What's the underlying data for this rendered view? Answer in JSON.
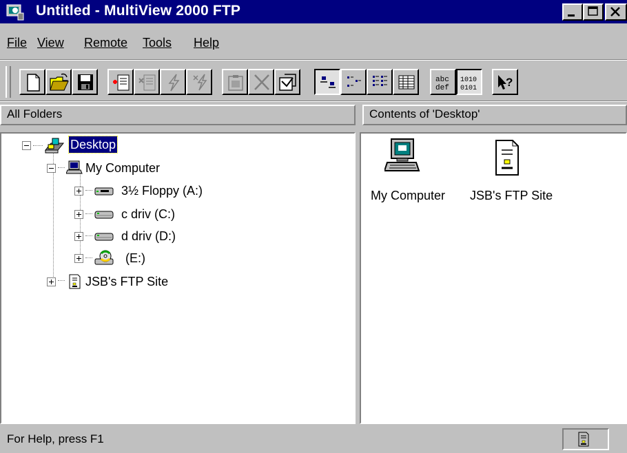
{
  "window": {
    "title": "Untitled - MultiView 2000 FTP",
    "controls": [
      "minimize",
      "maximize",
      "close"
    ]
  },
  "menu": [
    {
      "label": "File",
      "mnemonic": "F"
    },
    {
      "label": "View",
      "mnemonic": "V"
    },
    {
      "label": "Remote",
      "mnemonic": "R"
    },
    {
      "label": "Tools",
      "mnemonic": "T"
    },
    {
      "label": "Help",
      "mnemonic": "H"
    }
  ],
  "toolbar": {
    "buttons": [
      {
        "name": "new-icon",
        "enabled": true
      },
      {
        "name": "open-folder-icon",
        "enabled": true
      },
      {
        "name": "save-icon",
        "enabled": true
      },
      {
        "name": "connect-icon",
        "enabled": true
      },
      {
        "name": "disconnect-icon",
        "enabled": false
      },
      {
        "name": "lightning-icon",
        "enabled": false
      },
      {
        "name": "multi-lightning-icon",
        "enabled": false
      },
      {
        "name": "clipboard-icon",
        "enabled": false
      },
      {
        "name": "delete-icon",
        "enabled": false
      },
      {
        "name": "properties-icon",
        "enabled": true
      },
      {
        "name": "large-icons-view-icon",
        "enabled": true,
        "pressed": true
      },
      {
        "name": "small-icons-view-icon",
        "enabled": true
      },
      {
        "name": "list-view-icon",
        "enabled": true
      },
      {
        "name": "details-view-icon",
        "enabled": true
      },
      {
        "name": "ascii-mode-icon",
        "enabled": true,
        "text": "abc def"
      },
      {
        "name": "binary-mode-icon",
        "enabled": true,
        "pressed": true,
        "text": "1010 0101"
      },
      {
        "name": "context-help-icon",
        "enabled": true
      }
    ]
  },
  "left_pane": {
    "header": "All Folders",
    "tree": [
      {
        "label": "Desktop",
        "icon": "desktop-icon",
        "expander": "minus",
        "selected": true
      },
      {
        "label": "My Computer",
        "icon": "computer-icon",
        "expander": "minus"
      },
      {
        "label": "3½ Floppy (A:)",
        "icon": "floppy-drive-icon",
        "expander": "plus"
      },
      {
        "label": "c driv (C:)",
        "icon": "hard-drive-icon",
        "expander": "plus"
      },
      {
        "label": "d driv (D:)",
        "icon": "hard-drive-icon",
        "expander": "plus"
      },
      {
        "label": "(E:)",
        "icon": "cd-drive-icon",
        "expander": "plus"
      },
      {
        "label": "JSB's FTP Site",
        "icon": "ftp-server-icon",
        "expander": "plus"
      }
    ]
  },
  "right_pane": {
    "header": "Contents of 'Desktop'",
    "items": [
      {
        "label": "My Computer",
        "icon": "computer-icon"
      },
      {
        "label": "JSB's FTP Site",
        "icon": "ftp-server-icon"
      }
    ]
  },
  "status": {
    "text": "For Help, press F1",
    "panel_icon": "ftp-server-icon"
  },
  "colors": {
    "titlebar": "#000080",
    "face": "#c0c0c0",
    "selection": "#000080"
  }
}
